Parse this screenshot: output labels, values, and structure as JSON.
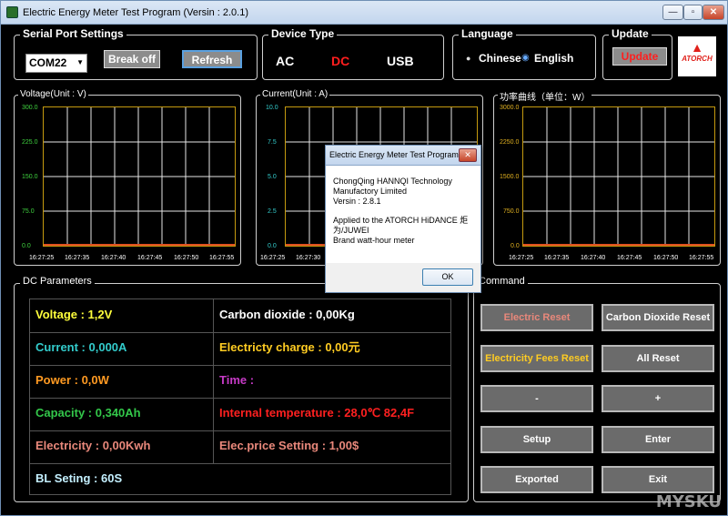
{
  "window": {
    "title": "Electric Energy Meter Test Program  (Versin : 2.0.1)",
    "minimize": "—",
    "maximize": "▫",
    "close": "✕"
  },
  "serial": {
    "label": "Serial Port Settings",
    "port": "COM22",
    "break_label": "Break off",
    "refresh_label": "Refresh"
  },
  "device": {
    "label": "Device Type",
    "options": [
      "AC",
      "DC",
      "USB"
    ],
    "selected": "DC",
    "selected_color": "#ff1e1e"
  },
  "language": {
    "label": "Language",
    "chinese": "Chinese",
    "english": "English",
    "selected": "English"
  },
  "update": {
    "label": "Update",
    "button": "Update"
  },
  "logo": {
    "text": "ATORCH"
  },
  "charts": {
    "voltage": {
      "title": "Voltage(Unit : V)",
      "y_ticks": [
        "300.0",
        "225.0",
        "150.0",
        "75.0",
        "0.0"
      ],
      "x_ticks": [
        "16:27:25",
        "16:27:35",
        "16:27:40",
        "16:27:45",
        "16:27:50",
        "16:27:55"
      ],
      "tick_color": "#3fd23f"
    },
    "current": {
      "title": "Current(Unit : A)",
      "y_ticks": [
        "10.0",
        "7.5",
        "5.0",
        "2.5",
        "0.0"
      ],
      "x_ticks": [
        "16:27:25",
        "16:27:30"
      ],
      "tick_color": "#33cccc"
    },
    "power": {
      "title": "功率曲线（单位：W）",
      "y_ticks": [
        "3000.0",
        "2250.0",
        "1500.0",
        "750.0",
        "0.0"
      ],
      "x_ticks": [
        "16:27:25",
        "16:27:35",
        "16:27:40",
        "16:27:45",
        "16:27:50",
        "16:27:55"
      ],
      "tick_color": "#e0b020"
    }
  },
  "dc": {
    "label": "DC Parameters",
    "voltage": "Voltage : 1,2V",
    "current": "Current : 0,000A",
    "power": "Power : 0,0W",
    "capacity": "Capacity : 0,340Ah",
    "electricity": "Electricity : 0,00Kwh",
    "bl": "BL Seting : 60S",
    "co2": "Carbon dioxide : 0,00Kg",
    "charge": "Electricty charge : 0,00元",
    "time": "Time :",
    "temp": "Internal temperature : 28,0℃ 82,4F",
    "price": "Elec.price Setting : 1,00$"
  },
  "command": {
    "label": "Command",
    "electric_reset": "Electric Reset",
    "co2_reset": "Carbon Dioxide Reset",
    "fees_reset": "Electricity Fees Reset",
    "all_reset": "All Reset",
    "minus": "-",
    "plus": "+",
    "setup": "Setup",
    "enter": "Enter",
    "exported": "Exported",
    "exit": "Exit"
  },
  "dialog": {
    "title": "Electric Energy Meter Test Program",
    "line1": "ChongQing HANNQI Technology",
    "line2": "Manufactory Limited",
    "line3": "Versin : 2.8.1",
    "line4": "Applied to the ATORCH HiDANCE 炬",
    "line5": "为/JUWEI",
    "line6": "Brand watt-hour meter",
    "ok": "OK"
  },
  "watermark": "MYSKU"
}
